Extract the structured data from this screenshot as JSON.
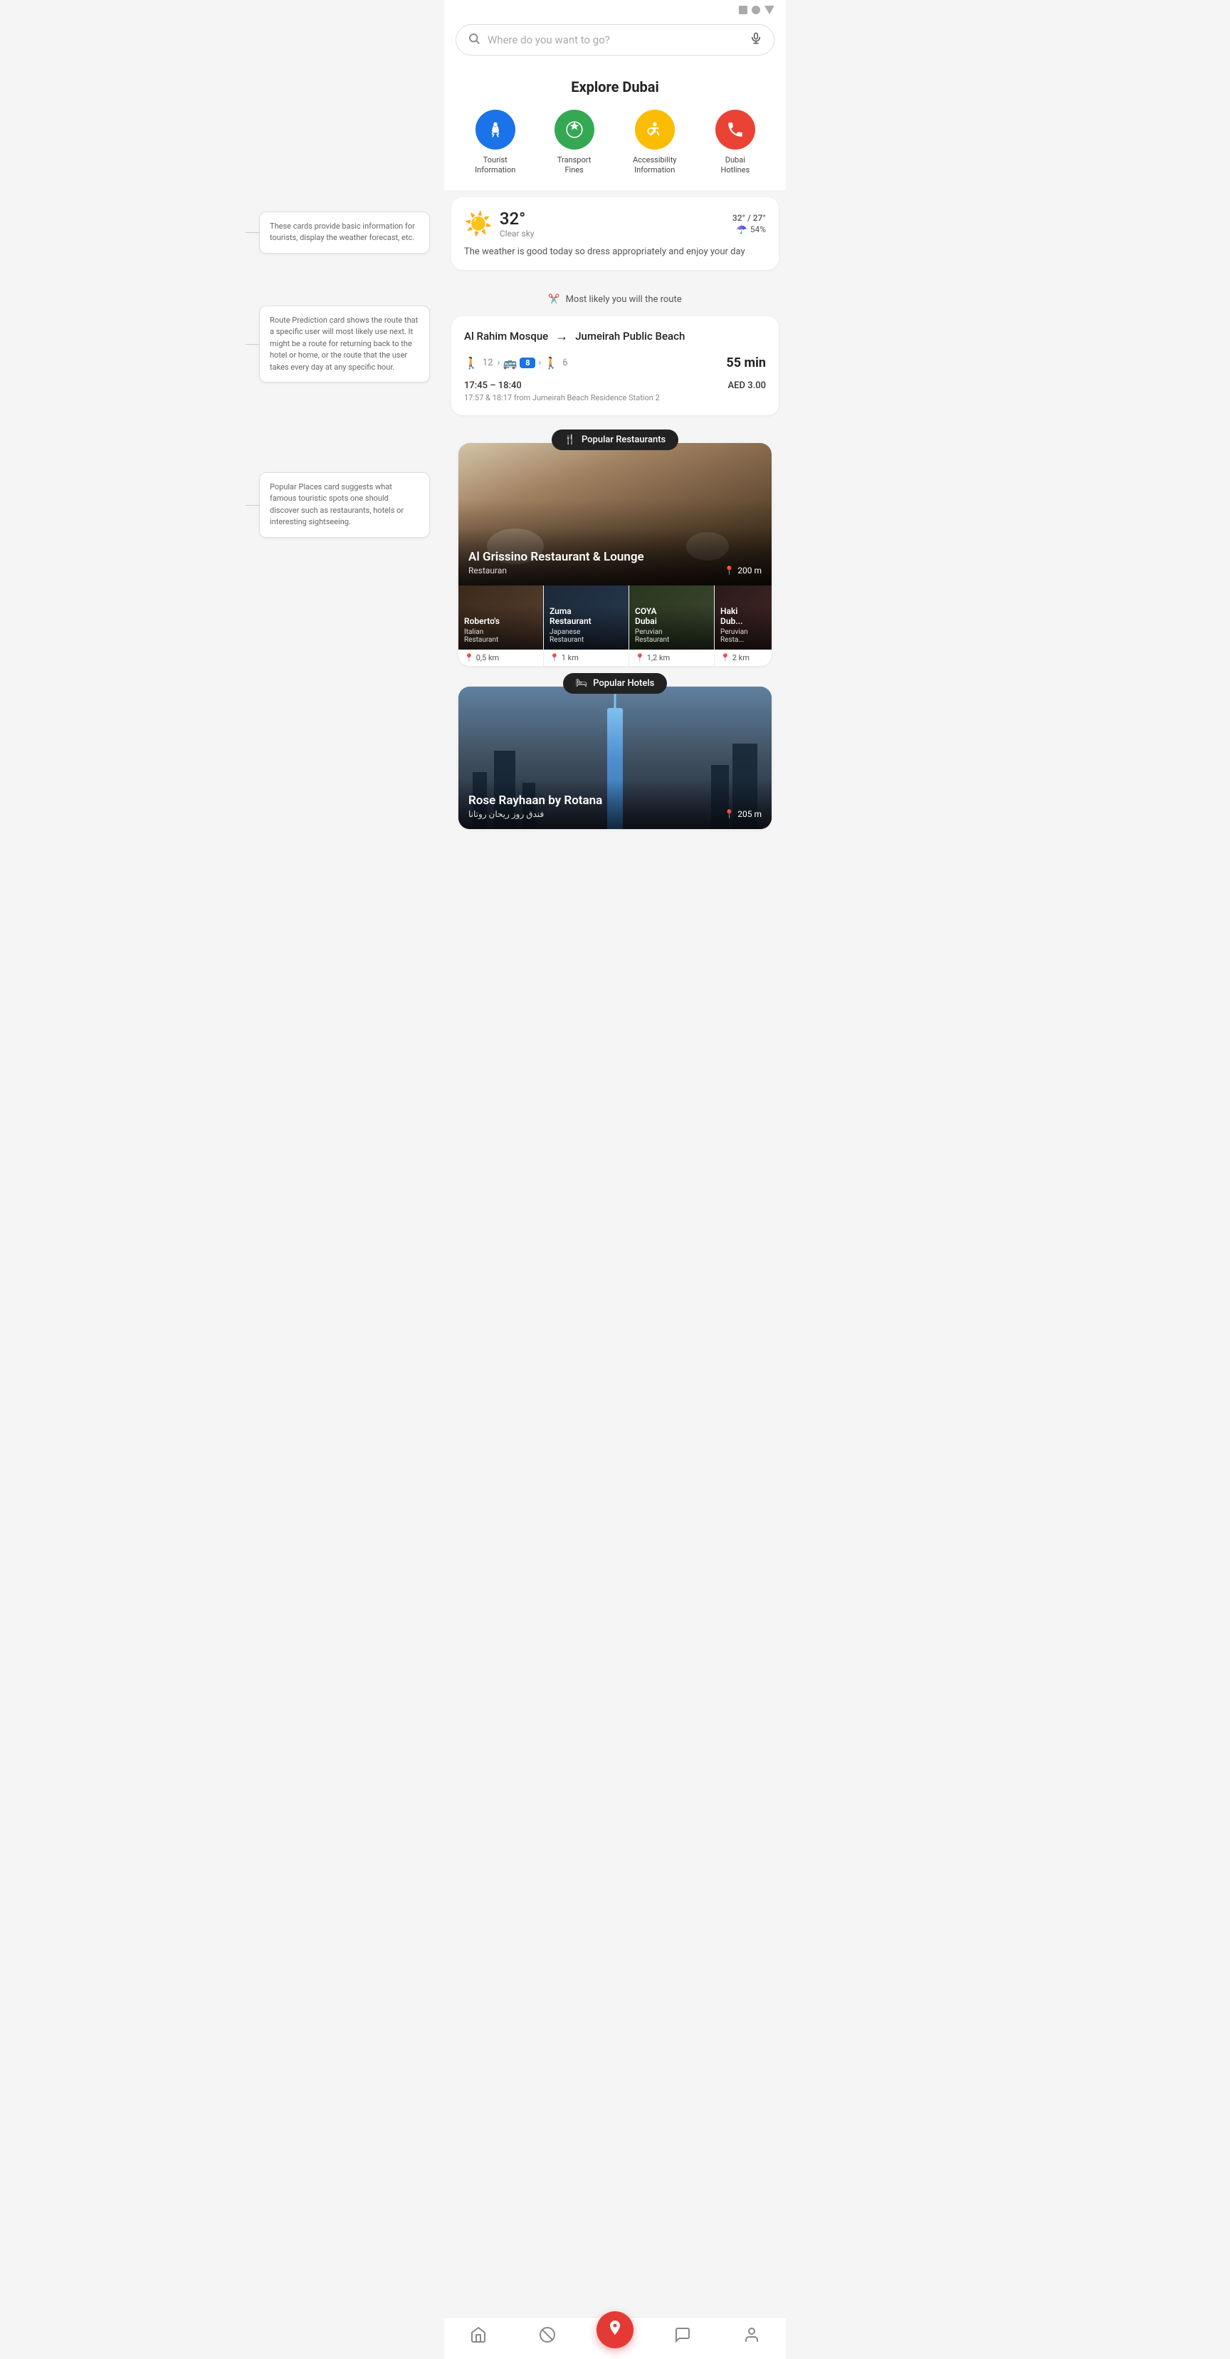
{
  "statusBar": {
    "icons": [
      "signal-square",
      "signal-dot",
      "signal-triangle"
    ]
  },
  "search": {
    "placeholder": "Where do you want to go?"
  },
  "explore": {
    "title": "Explore Dubai",
    "categories": [
      {
        "id": "tourist",
        "label": "Tourist\nInformation",
        "icon": "🚶",
        "colorClass": "cat-blue"
      },
      {
        "id": "transport",
        "label": "Transport\nFines",
        "icon": "🛡️",
        "colorClass": "cat-green"
      },
      {
        "id": "accessibility",
        "label": "Accessibility\nInformation",
        "icon": "♿",
        "colorClass": "cat-yellow"
      },
      {
        "id": "hotlines",
        "label": "Dubai\nHotlines",
        "icon": "📞",
        "colorClass": "cat-red"
      }
    ]
  },
  "annotations": {
    "weather": "These cards provide basic information for tourists, display the weather forecast, etc.",
    "route": "Route Prediction card shows the route that a specific user will most likely use next. It might be a route for returning back to the hotel or home, or the route that the user takes every day at any specific hour.",
    "popular": "Popular Places card suggests what famous touristic spots one should discover such as restaurants, hotels or interesting sightseeing."
  },
  "weather": {
    "temperature": "32°",
    "description": "Clear sky",
    "rangeHigh": "32°",
    "rangeLow": "27°",
    "humidity": "54%",
    "message": "The weather is good today so dress appropriately and enjoy your day"
  },
  "routePrediction": {
    "header": "Most likely you will the route",
    "from": "Al Rahim Mosque",
    "to": "Jumeirah Public Beach",
    "walkMin": "12",
    "busLine": "8",
    "walkMax": "6",
    "duration": "55 min",
    "timeRange": "17:45 – 18:40",
    "cost": "AED 3.00",
    "stationInfo": "17:57 & 18:17 from Jumeirah Beach Residence Station 2"
  },
  "popularRestaurants": {
    "badge": "Popular Restaurants",
    "main": {
      "name": "Al Grissino Restaurant & Lounge",
      "type": "Restauran",
      "distance": "200 m"
    },
    "sub": [
      {
        "name": "Roberto's",
        "type": "Italian\nRestaurant",
        "distance": "0,5 km"
      },
      {
        "name": "Zuma\nRestaurant",
        "type": "Japanese\nRestaurant",
        "distance": "1 km"
      },
      {
        "name": "COYA\nDubai",
        "type": "Peruvian\nRestaurant",
        "distance": "1,2 km"
      },
      {
        "name": "Haki\nDub...",
        "type": "Peruvian\nResta...",
        "distance": "2 km"
      }
    ]
  },
  "popularHotels": {
    "badge": "Popular Hotels",
    "main": {
      "name": "Rose Rayhaan by Rotana",
      "nameArabic": "فندق روز ريحان روتانا",
      "distance": "205 m"
    }
  },
  "bottomNav": {
    "items": [
      {
        "id": "home",
        "icon": "🏠"
      },
      {
        "id": "forbidden",
        "icon": "🚫"
      },
      {
        "id": "fab",
        "icon": "✦"
      },
      {
        "id": "chat",
        "icon": "💬"
      },
      {
        "id": "profile",
        "icon": "👤"
      }
    ]
  }
}
